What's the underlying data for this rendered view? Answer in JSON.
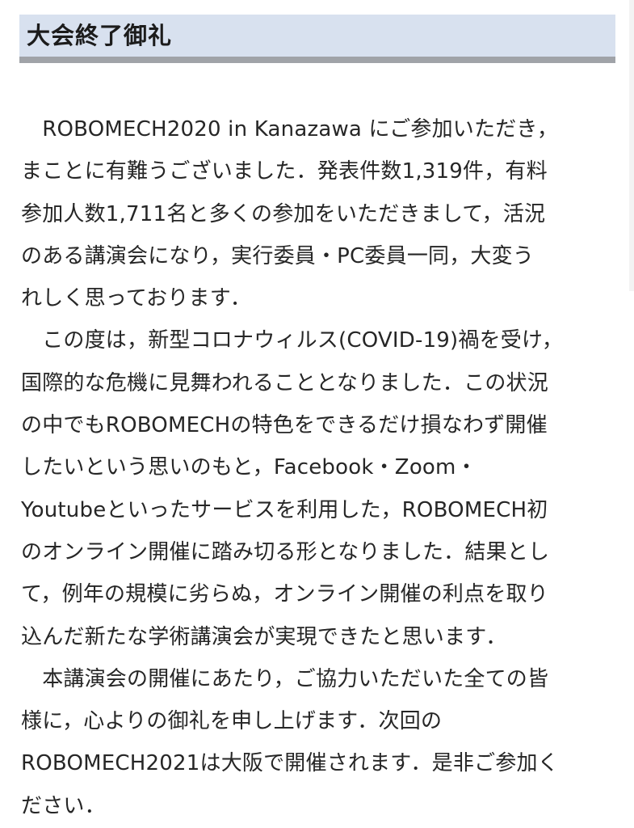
{
  "heading": {
    "title": "大会終了御礼"
  },
  "body": {
    "lines": [
      "　ROBOMECH2020 in Kanazawa にご参加いただき，",
      "まことに有難うございました．発表件数1,319件，有料",
      "参加人数1,711名と多くの参加をいただきまして，活況",
      "のある講演会になり，実行委員・PC委員一同，大変う",
      "れしく思っております．",
      "　この度は，新型コロナウィルス(COVID-19)禍を受け，",
      "国際的な危機に見舞われることとなりました．この状況",
      "の中でもROBOMECHの特色をできるだけ損なわず開催",
      "したいという思いのもと，Facebook・Zoom・",
      "Youtubeといったサービスを利用した，ROBOMECH初",
      "のオンライン開催に踏み切る形となりました．結果とし",
      "て，例年の規模に劣らぬ，オンライン開催の利点を取り",
      "込んだ新たな学術講演会が実現できたと思います．",
      "　本講演会の開催にあたり，ご協力いただいた全ての皆",
      "様に，心よりの御礼を申し上げます．次回の",
      "ROBOMECH2021は大阪で開催されます．是非ご参加く",
      "ださい．"
    ]
  }
}
